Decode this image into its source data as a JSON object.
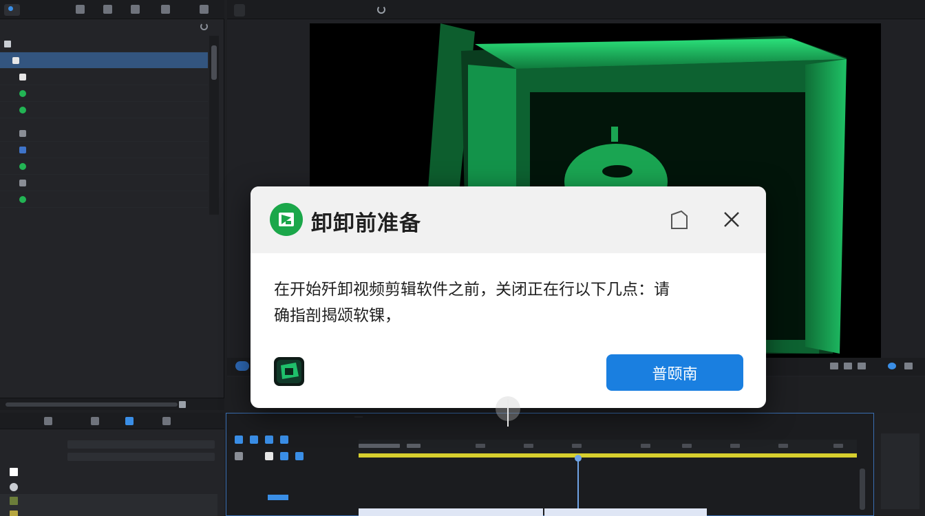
{
  "left_panel": {
    "tab_label": "",
    "subheader": "",
    "tree_header": "",
    "items": [
      {
        "label": "",
        "icon": "folder-icon",
        "color": "#33557f"
      },
      {
        "label": "",
        "icon": "check-icon"
      },
      {
        "label": "",
        "icon": "green-dot-icon"
      },
      {
        "label": "",
        "icon": "green-dot-icon"
      },
      {
        "label": "",
        "icon": "pen-icon"
      },
      {
        "label": "",
        "icon": "blue-flag-icon"
      },
      {
        "label": "",
        "icon": "green-dot-icon"
      },
      {
        "label": "",
        "icon": "tool-icon"
      },
      {
        "label": "",
        "icon": "green-dot-icon"
      }
    ]
  },
  "monitor": {
    "tab_label": "",
    "lower_label": ""
  },
  "project_panel": {
    "title": ""
  },
  "timeline": {
    "tab_label": "",
    "tab2_label": "",
    "clips": [
      "",
      ""
    ]
  },
  "dialog": {
    "title": "卸卸前准备",
    "message_line1": "在开始歼卸视频剪辑软件之前，关闭正在行以下几点：请",
    "message_line2": "确指剖揭颂软锞，",
    "button_label": "普颐南",
    "accent_color": "#1a7fe0",
    "logo_color": "#1ba74a"
  }
}
